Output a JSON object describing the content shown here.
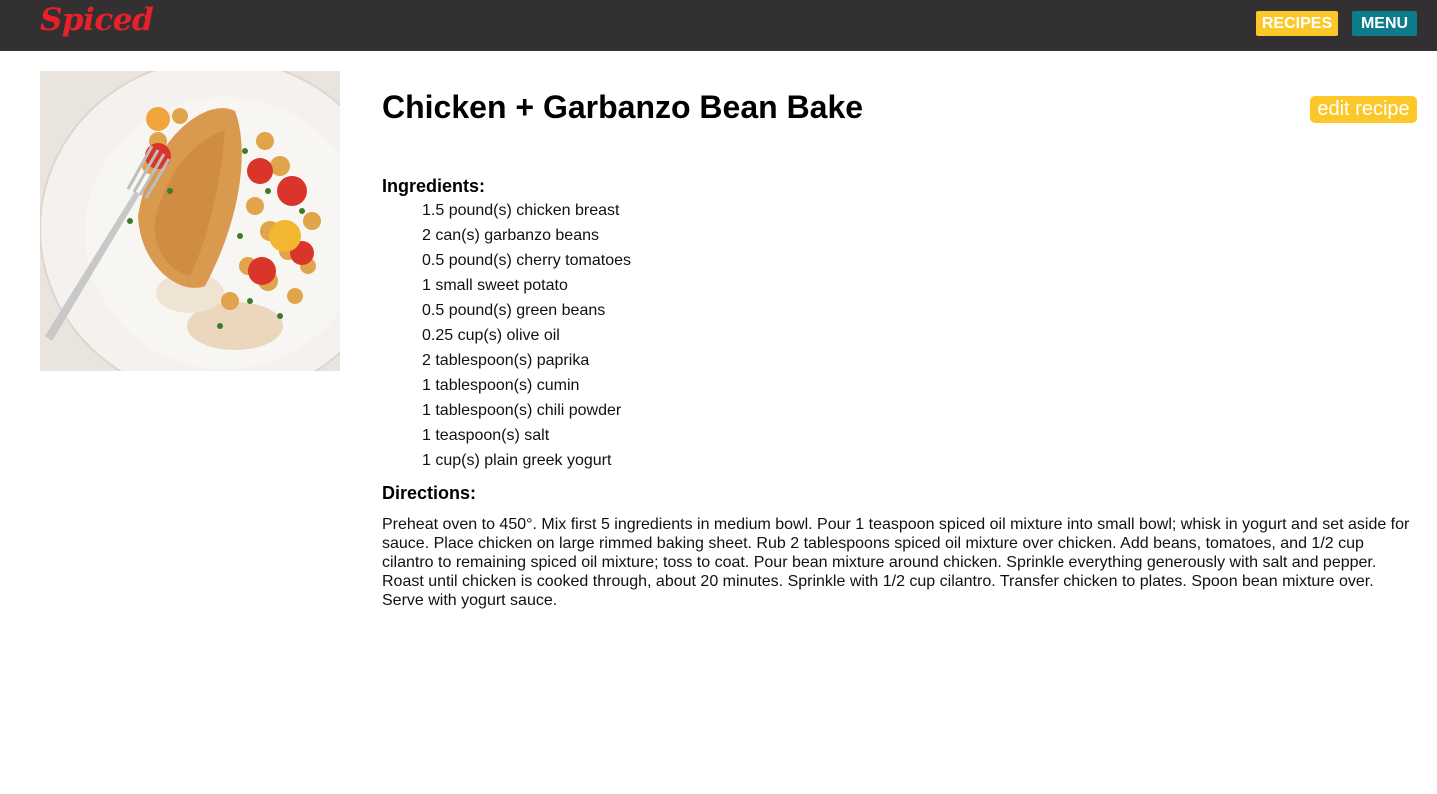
{
  "header": {
    "logo": "Spiced",
    "recipes_label": "RECIPES",
    "menu_label": "MENU"
  },
  "recipe": {
    "title": "Chicken + Garbanzo Bean Bake",
    "edit_label": "edit recipe",
    "ingredients_heading": "Ingredients:",
    "ingredients": [
      "1.5 pound(s) chicken breast",
      "2 can(s) garbanzo beans",
      "0.5 pound(s) cherry tomatoes",
      "1 small sweet potato",
      "0.5 pound(s) green beans",
      "0.25 cup(s) olive oil",
      "2 tablespoon(s) paprika",
      "1 tablespoon(s) cumin",
      "1 tablespoon(s) chili powder",
      "1 teaspoon(s) salt",
      "1 cup(s) plain greek yogurt"
    ],
    "directions_heading": "Directions:",
    "directions": "Preheat oven to 450°. Mix first 5 ingredients in medium bowl. Pour 1 teaspoon spiced oil mixture into small bowl; whisk in yogurt and set aside for sauce. Place chicken on large rimmed baking sheet. Rub 2 tablespoons spiced oil mixture over chicken. Add beans, tomatoes, and 1/2 cup cilantro to remaining spiced oil mixture; toss to coat. Pour bean mixture around chicken. Sprinkle everything generously with salt and pepper. Roast until chicken is cooked through, about 20 minutes. Sprinkle with 1/2 cup cilantro. Transfer chicken to plates. Spoon bean mixture over. Serve with yogurt sauce."
  },
  "colors": {
    "topbar": "#323031",
    "logo": "#e8202a",
    "accent_yellow": "#fcc829",
    "accent_teal": "#0c7c8c"
  }
}
